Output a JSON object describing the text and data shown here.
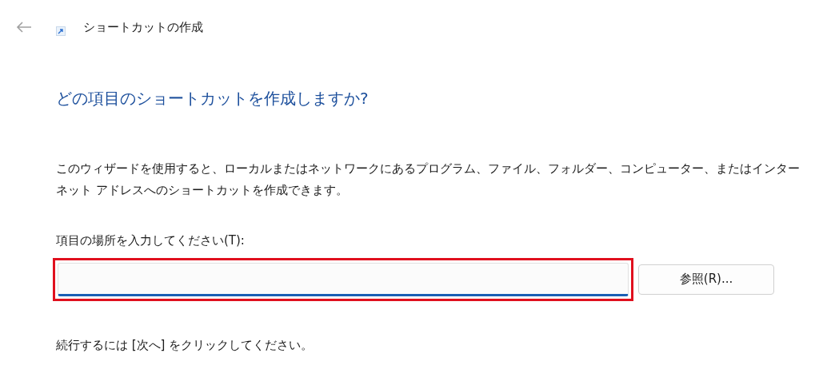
{
  "window": {
    "title": "ショートカットの作成"
  },
  "heading": "どの項目のショートカットを作成しますか?",
  "description": "このウィザードを使用すると、ローカルまたはネットワークにあるプログラム、ファイル、フォルダー、コンピューター、またはインターネット アドレスへのショートカットを作成できます。",
  "location": {
    "label": "項目の場所を入力してください(T):",
    "highlighted": true
  },
  "browse_button": "参照(R)...",
  "footer": "続行するには [次へ] をクリックしてください。"
}
